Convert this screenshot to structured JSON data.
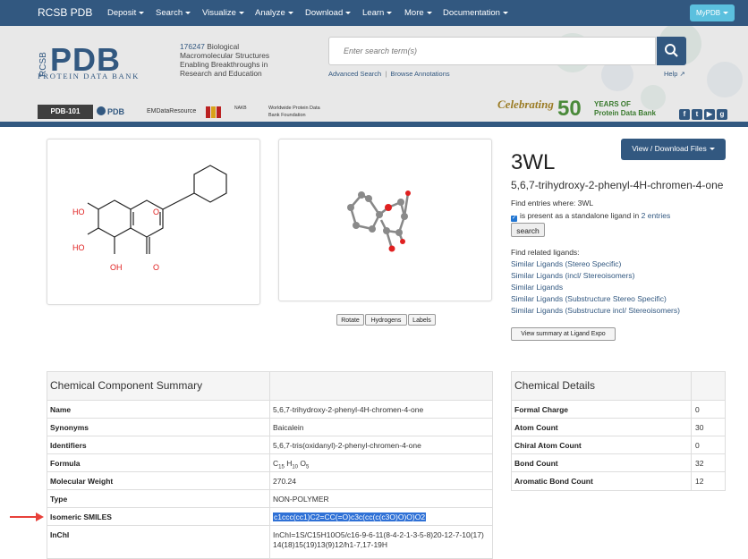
{
  "nav": {
    "brand": "RCSB PDB",
    "items": [
      "Deposit",
      "Search",
      "Visualize",
      "Analyze",
      "Download",
      "Learn",
      "More",
      "Documentation"
    ],
    "mypdb": "MyPDB"
  },
  "header": {
    "logo_text": "PDB",
    "logo_rcsb": "RCSB",
    "logo_sub": "PROTEIN DATA BANK",
    "tagline_count": "176247",
    "tagline_text": " Biological Macromolecular Structures Enabling Breakthroughs in Research and Education",
    "search_placeholder": "Enter search term(s)",
    "advanced_search": "Advanced Search",
    "separator": "|",
    "browse_annotations": "Browse Annotations",
    "help": "Help",
    "partners": [
      "PDB-101",
      "PDB",
      "EMDataResource",
      "NAKB",
      "Worldwide Protein Data Bank Foundation"
    ],
    "celebrating": "Celebrating",
    "anniversary_num": "50",
    "years_line1": "YEARS OF",
    "years_line2": "Protein Data Bank",
    "social": [
      "f",
      "t",
      "▶",
      "g"
    ]
  },
  "structure": {
    "buttons": [
      "Rotate",
      "Hydrogens",
      "Labels"
    ],
    "atom_labels": [
      "HO",
      "HO",
      "OH",
      "O",
      "O"
    ]
  },
  "ligand": {
    "id": "3WL",
    "name": "5,6,7-trihydroxy-2-phenyl-4H-chromen-4-one",
    "view_download": "View / Download Files",
    "find_entries": "Find entries where: 3WL",
    "standalone_prefix": "is present as a standalone ligand in ",
    "standalone_link": "2 entries",
    "search_button": "search",
    "related_label": "Find related ligands:",
    "related_links": [
      "Similar Ligands (Stereo Specific)",
      "Similar Ligands (incl/ Stereoisomers)",
      "Similar Ligands",
      "Similar Ligands (Substructure Stereo Specific)",
      "Similar Ligands (Substructure incl/ Stereoisomers)"
    ],
    "view_summary": "View summary at Ligand Expo"
  },
  "summary": {
    "title": "Chemical Component Summary",
    "rows": [
      {
        "key": "Name",
        "value": "5,6,7-trihydroxy-2-phenyl-4H-chromen-4-one"
      },
      {
        "key": "Synonyms",
        "value": "Baicalein"
      },
      {
        "key": "Identifiers",
        "value": "5,6,7-tris(oxidanyl)-2-phenyl-chromen-4-one"
      },
      {
        "key": "Formula",
        "value": "C15 H10 O5"
      },
      {
        "key": "Molecular Weight",
        "value": "270.24"
      },
      {
        "key": "Type",
        "value": "NON-POLYMER"
      },
      {
        "key": "Isomeric SMILES",
        "value": "c1ccc(cc1)C2=CC(=O)c3c(cc(c(c3O)O)O)O2"
      },
      {
        "key": "InChI",
        "value": "InChI=1S/C15H10O5/c16-9-6-11(8-4-2-1-3-5-8)20-12-7-10(17)14(18)15(19)13(9)12/h1-7,17-19H"
      }
    ]
  },
  "details": {
    "title": "Chemical Details",
    "rows": [
      {
        "key": "Formal Charge",
        "value": "0"
      },
      {
        "key": "Atom Count",
        "value": "30"
      },
      {
        "key": "Chiral Atom Count",
        "value": "0"
      },
      {
        "key": "Bond Count",
        "value": "32"
      },
      {
        "key": "Aromatic Bond Count",
        "value": "12"
      }
    ]
  },
  "colors": {
    "brand": "#325880",
    "accent": "#5bc0de",
    "highlight": "#2f71d6",
    "arrow": "#e8413a",
    "oxygen": "#e02020"
  }
}
